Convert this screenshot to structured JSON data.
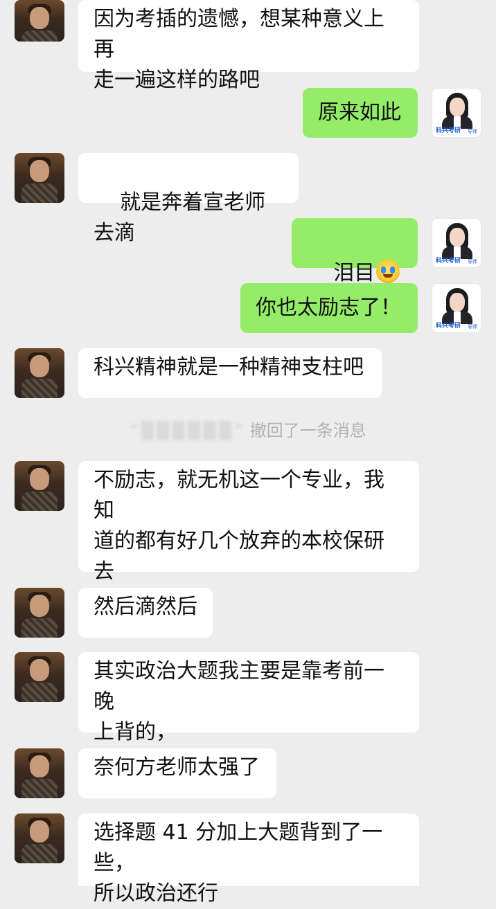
{
  "messages": [
    {
      "side": "left",
      "text": "因为考插的遗憾，想某种意义上再\n走一遍这样的路吧"
    },
    {
      "side": "right",
      "text": "原来如此"
    },
    {
      "side": "left",
      "text": "就是奔着宣老师去滴"
    },
    {
      "side": "right",
      "text": "泪目",
      "emoji": [
        "crying-face-icon",
        "crying-face-icon"
      ]
    },
    {
      "side": "right",
      "text": "你也太励志了！"
    },
    {
      "side": "left",
      "text": "科兴精神就是一种精神支柱吧"
    },
    {
      "side": "left",
      "text": "不励志，就无机这一个专业，我知\n道的都有好几个放弃的本校保研去\n考科大的"
    },
    {
      "side": "left",
      "text": "然后滴然后"
    },
    {
      "side": "left",
      "text": "其实政治大题我主要是靠考前一晚\n上背的，"
    },
    {
      "side": "left",
      "text": "奈何方老师太强了"
    },
    {
      "side": "left",
      "text": "选择题 41 分加上大题背到了一些，\n所以政治还行"
    }
  ],
  "system_notice": {
    "name_masked": "“▒▒▒▒▒▒”",
    "text": "撤回了一条消息"
  },
  "right_avatar": {
    "brand": "科兴考研",
    "tag": "导师"
  }
}
